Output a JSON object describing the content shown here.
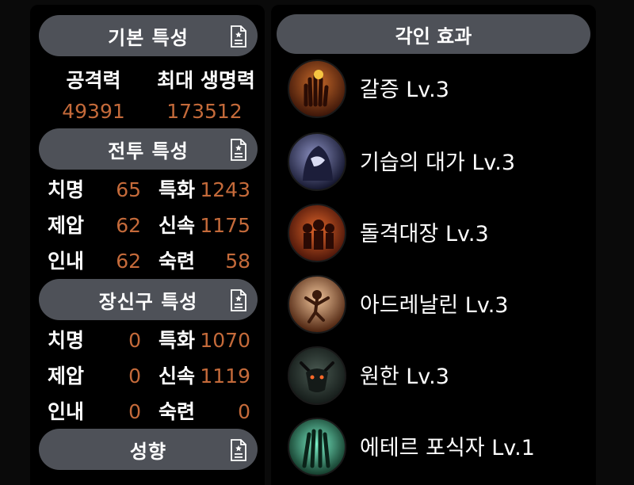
{
  "basic": {
    "title": "기본 특성",
    "attack_label": "공격력",
    "hp_label": "최대 생명력",
    "attack_value": "49391",
    "hp_value": "173512"
  },
  "combat": {
    "title": "전투 특성",
    "rows": [
      {
        "l1": "치명",
        "v1": "65",
        "l2": "특화",
        "v2": "1243"
      },
      {
        "l1": "제압",
        "v1": "62",
        "l2": "신속",
        "v2": "1175"
      },
      {
        "l1": "인내",
        "v1": "62",
        "l2": "숙련",
        "v2": "58"
      }
    ]
  },
  "accessory": {
    "title": "장신구 특성",
    "rows": [
      {
        "l1": "치명",
        "v1": "0",
        "l2": "특화",
        "v2": "1070"
      },
      {
        "l1": "제압",
        "v1": "0",
        "l2": "신속",
        "v2": "1119"
      },
      {
        "l1": "인내",
        "v1": "0",
        "l2": "숙련",
        "v2": "0"
      }
    ]
  },
  "tendency": {
    "title": "성향"
  },
  "engravings": {
    "title": "각인 효과",
    "items": [
      {
        "name": "갈증 Lv.3",
        "icon": "bloody-hand-icon"
      },
      {
        "name": "기습의 대가 Lv.3",
        "icon": "hooded-assassin-icon"
      },
      {
        "name": "돌격대장 Lv.3",
        "icon": "charging-warriors-icon"
      },
      {
        "name": "아드레날린 Lv.3",
        "icon": "leaping-figure-icon"
      },
      {
        "name": "원한 Lv.3",
        "icon": "demon-beast-icon"
      },
      {
        "name": "에테르 포식자 Lv.1",
        "icon": "ether-claw-icon"
      }
    ]
  },
  "colors": {
    "stat_value": "#c46a3a",
    "header_bg": "#4e5158",
    "panel_bg": "#000000"
  }
}
